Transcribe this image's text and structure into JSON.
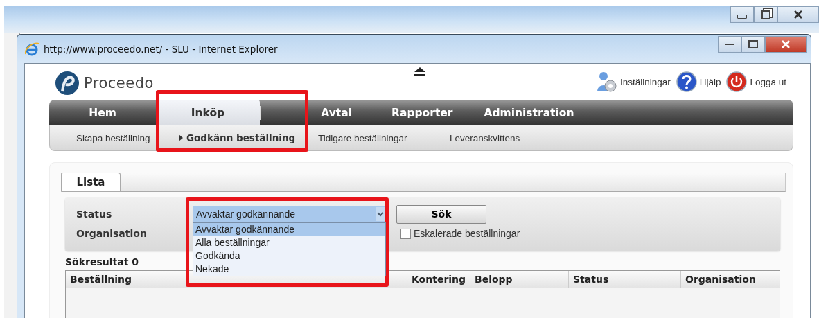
{
  "browser": {
    "title": "http://www.proceedo.net/ - SLU - Internet Explorer"
  },
  "app": {
    "name": "Proceedo"
  },
  "header_links": [
    {
      "label": "Inställningar",
      "kind": "settings"
    },
    {
      "label": "Hjälp",
      "kind": "help"
    },
    {
      "label": "Logga ut",
      "kind": "logout"
    }
  ],
  "nav_tabs": [
    {
      "label": "Hem",
      "selected": false
    },
    {
      "label": "Inköp",
      "selected": true
    },
    {
      "label": "Avtal",
      "selected": false
    },
    {
      "label": "Rapporter",
      "selected": false
    },
    {
      "label": "Administration",
      "selected": false
    }
  ],
  "sub_nav": [
    {
      "label": "Skapa beställning",
      "selected": false
    },
    {
      "label": "Godkänn beställning",
      "selected": true
    },
    {
      "label": "Tidigare beställningar",
      "selected": false
    },
    {
      "label": "Leveranskvittens",
      "selected": false
    }
  ],
  "page_tabs": [
    {
      "label": "Lista",
      "selected": true
    }
  ],
  "filters": {
    "status_label": "Status",
    "organisation_label": "Organisation",
    "status_value": "Avvaktar godkännande",
    "status_options": [
      {
        "label": "Avvaktar godkännande",
        "selected": true
      },
      {
        "label": "Alla beställningar",
        "selected": false
      },
      {
        "label": "Godkända",
        "selected": false
      },
      {
        "label": "Nekade",
        "selected": false
      }
    ],
    "search_button": "Sök",
    "escalated": {
      "label": "Eskalerade beställningar",
      "checked": false
    }
  },
  "results": {
    "count_label": "Sökresultat 0"
  },
  "table": {
    "columns": [
      {
        "kind": "label",
        "label": "Beställning"
      },
      {
        "kind": "covered"
      },
      {
        "kind": "covered"
      },
      {
        "kind": "label",
        "label": "Kontering"
      },
      {
        "kind": "label",
        "label": "Belopp"
      },
      {
        "kind": "label",
        "label": "Status"
      },
      {
        "kind": "label",
        "label": "Organisation"
      }
    ]
  }
}
